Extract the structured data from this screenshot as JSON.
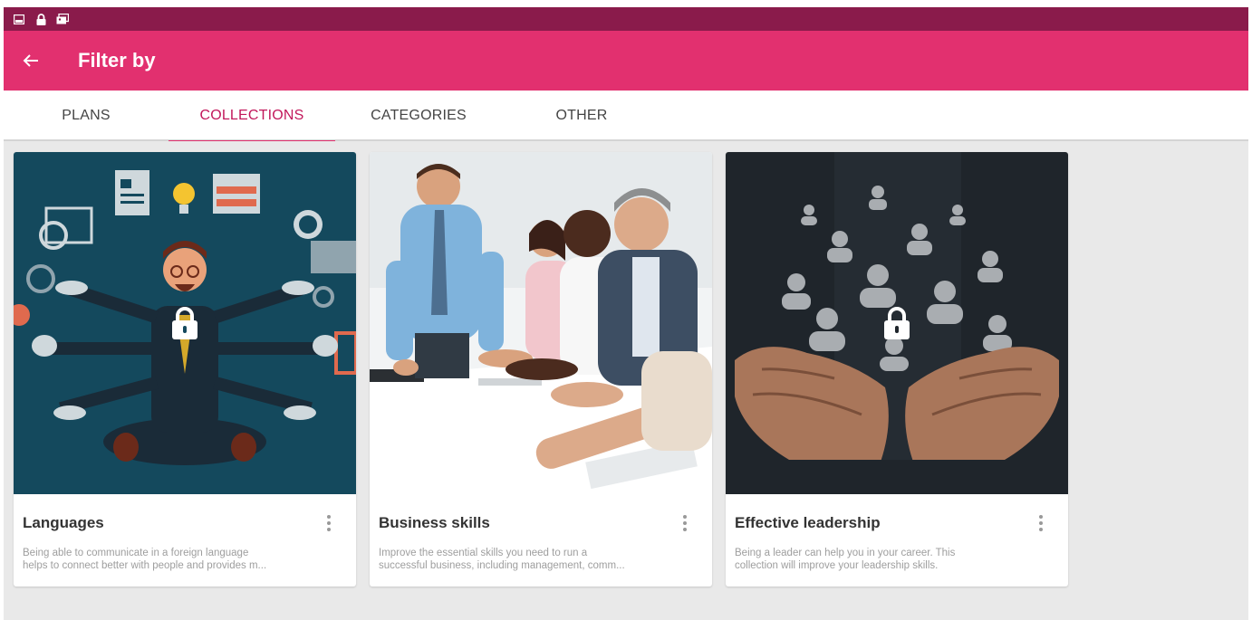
{
  "status_bar": {
    "icons": [
      "image-icon",
      "lock-icon",
      "photo-stack-icon"
    ]
  },
  "app_bar": {
    "back_icon": "arrow-left-icon",
    "title": "Filter by",
    "color": "#e2306f"
  },
  "tabs": [
    {
      "label": "PLANS",
      "active": false
    },
    {
      "label": "COLLECTIONS",
      "active": true
    },
    {
      "label": "CATEGORIES",
      "active": false
    },
    {
      "label": "OTHER",
      "active": false
    }
  ],
  "cards": [
    {
      "title": "Languages",
      "desc_line1": "Being able to communicate in a foreign language",
      "desc_line2": "helps to connect better with people and provides m...",
      "locked": true,
      "menu_icon": "more-vert-icon"
    },
    {
      "title": "Business skills",
      "desc_line1": "Improve the essential skills you need to run a",
      "desc_line2": "successful business, including management, comm...",
      "locked": false,
      "menu_icon": "more-vert-icon"
    },
    {
      "title": "Effective leadership",
      "desc_line1": "Being a leader can help you in your career. This",
      "desc_line2": "collection will improve your leadership skills.",
      "locked": true,
      "menu_icon": "more-vert-icon"
    }
  ],
  "colors": {
    "status_bar": "#8a1b4b",
    "accent": "#e2306f",
    "active_tab_text": "#c2185b",
    "background": "#e9e9e9"
  }
}
